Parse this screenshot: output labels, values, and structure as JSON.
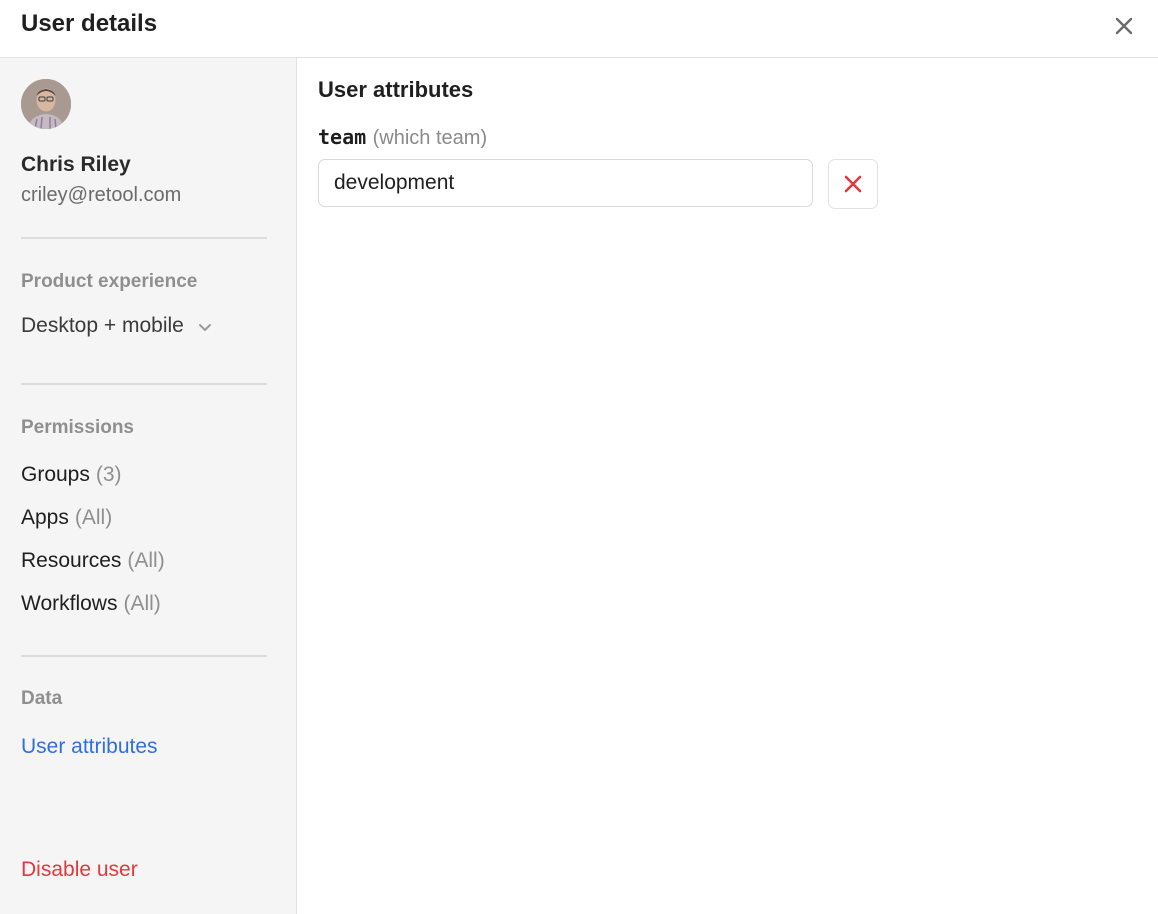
{
  "header": {
    "title": "User details",
    "close_icon": "close-icon"
  },
  "user": {
    "name": "Chris Riley",
    "email": "criley@retool.com",
    "avatar_icon": "avatar-photo"
  },
  "product_experience": {
    "label": "Product experience",
    "value": "Desktop + mobile",
    "icon": "chevron-down-icon"
  },
  "permissions": {
    "label": "Permissions",
    "items": [
      {
        "label": "Groups",
        "count": "(3)"
      },
      {
        "label": "Apps",
        "count": "(All)"
      },
      {
        "label": "Resources",
        "count": "(All)"
      },
      {
        "label": "Workflows",
        "count": "(All)"
      }
    ]
  },
  "data_section": {
    "label": "Data",
    "items": [
      {
        "label": "User attributes"
      }
    ]
  },
  "disable_user": {
    "label": "Disable user"
  },
  "main": {
    "title": "User attributes",
    "attribute": {
      "key": "team",
      "description": "(which team)",
      "value": "development",
      "remove_icon": "close-icon"
    }
  },
  "colors": {
    "accent": "#2f6fe0",
    "danger": "#e0393e",
    "sidebar_bg": "#f5f5f5",
    "muted_text": "#8f8f8f"
  }
}
